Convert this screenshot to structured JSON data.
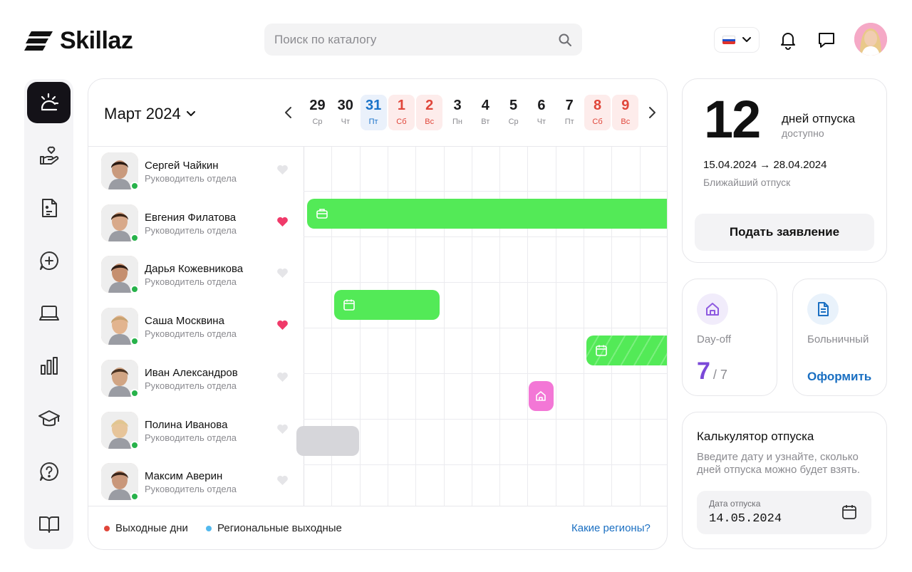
{
  "app": {
    "name": "Skillaz"
  },
  "header": {
    "search_placeholder": "Поиск по каталогу",
    "language": "ru"
  },
  "sidebar": {
    "items": [
      {
        "icon": "sun-icon",
        "active": true
      },
      {
        "icon": "hand-heart-icon"
      },
      {
        "icon": "document-icon"
      },
      {
        "icon": "chat-plus-icon"
      },
      {
        "icon": "laptop-icon"
      },
      {
        "icon": "bar-chart-icon"
      },
      {
        "icon": "graduation-cap-icon"
      },
      {
        "icon": "help-bubble-icon"
      },
      {
        "icon": "book-icon"
      }
    ]
  },
  "calendar": {
    "month": "Март 2024",
    "days": [
      {
        "num": "29",
        "wd": "Ср",
        "kind": "normal"
      },
      {
        "num": "30",
        "wd": "Чт",
        "kind": "normal"
      },
      {
        "num": "31",
        "wd": "Пт",
        "kind": "today"
      },
      {
        "num": "1",
        "wd": "Сб",
        "kind": "weekend"
      },
      {
        "num": "2",
        "wd": "Вс",
        "kind": "weekend"
      },
      {
        "num": "3",
        "wd": "Пн",
        "kind": "normal"
      },
      {
        "num": "4",
        "wd": "Вт",
        "kind": "normal"
      },
      {
        "num": "5",
        "wd": "Ср",
        "kind": "normal"
      },
      {
        "num": "6",
        "wd": "Чт",
        "kind": "normal"
      },
      {
        "num": "7",
        "wd": "Пт",
        "kind": "normal"
      },
      {
        "num": "8",
        "wd": "Сб",
        "kind": "weekend"
      },
      {
        "num": "9",
        "wd": "Вс",
        "kind": "weekend"
      }
    ],
    "people": [
      {
        "name": "Сергей Чайкин",
        "role": "Руководитель отдела",
        "favorite": false
      },
      {
        "name": "Евгения Филатова",
        "role": "Руководитель отдела",
        "favorite": true
      },
      {
        "name": "Дарья Кожевникова",
        "role": "Руководитель отдела",
        "favorite": false
      },
      {
        "name": "Саша Москвина",
        "role": "Руководитель отдела",
        "favorite": true
      },
      {
        "name": "Иван Александров",
        "role": "Руководитель отдела",
        "favorite": false
      },
      {
        "name": "Полина Иванова",
        "role": "Руководитель отдела",
        "favorite": false
      },
      {
        "name": "Максим Аверин",
        "role": "Руководитель отдела",
        "favorite": false
      }
    ],
    "legend": {
      "weekends": "Выходные дни",
      "regional": "Региональные выходные",
      "regions_link": "Какие регионы?"
    },
    "colors": {
      "vacation": "#53ea57",
      "dayoff": "#f377d6",
      "past": "#d6d6da",
      "weekend": "#e0463a",
      "regional": "#52b9ee"
    }
  },
  "vacation": {
    "days": "12",
    "days_label": "дней отпуска",
    "available": "доступно",
    "range": "15.04.2024 → 28.04.2024",
    "range_label": "Ближайший отпуск",
    "apply_button": "Подать заявление"
  },
  "dayoff": {
    "label": "Day-off",
    "value": "7",
    "total": "/ 7"
  },
  "sick": {
    "label": "Больничный",
    "action": "Оформить"
  },
  "calculator": {
    "title": "Калькулятор отпуска",
    "description": "Введите дату и узнайте, сколько дней отпуска можно будет взять.",
    "field_label": "Дата отпуска",
    "field_value": "14.05.2024"
  }
}
